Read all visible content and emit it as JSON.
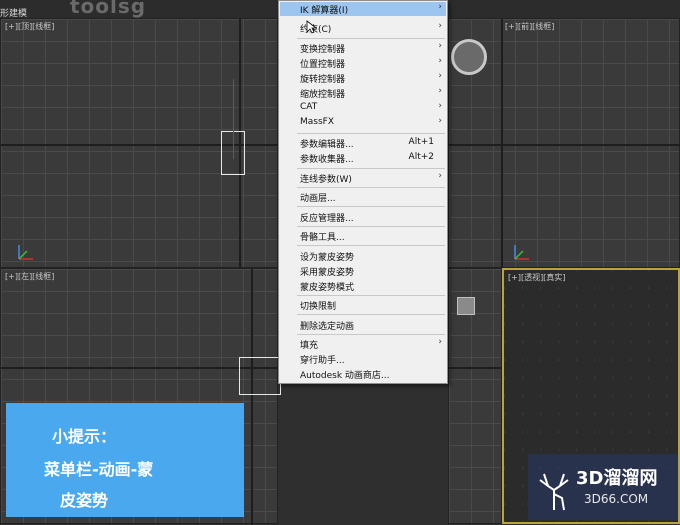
{
  "app": {
    "title_fragment": "形建模",
    "logo_text": "toolsg"
  },
  "viewports": {
    "top_left": {
      "label": "[+][顶][线框]"
    },
    "top_right": {
      "label": "[+][前][线框]"
    },
    "bottom_left": {
      "label": "[+][左][线框]"
    },
    "bottom_right": {
      "label": "[+][透视][真实]"
    }
  },
  "menu": {
    "items": [
      {
        "label": "IK 解算器(I)",
        "shortcut": "",
        "submenu": true,
        "highlight": true
      },
      {
        "label": "约束(C)",
        "shortcut": "",
        "submenu": true
      },
      {
        "label": "变换控制器",
        "shortcut": "",
        "submenu": true
      },
      {
        "label": "位置控制器",
        "shortcut": "",
        "submenu": true
      },
      {
        "label": "旋转控制器",
        "shortcut": "",
        "submenu": true
      },
      {
        "label": "缩放控制器",
        "shortcut": "",
        "submenu": true
      },
      {
        "label": "CAT",
        "shortcut": "",
        "submenu": true
      },
      {
        "label": "MassFX",
        "shortcut": "",
        "submenu": true
      },
      {
        "label": "参数编辑器...",
        "shortcut": "Alt+1",
        "submenu": false
      },
      {
        "label": "参数收集器...",
        "shortcut": "Alt+2",
        "submenu": false
      },
      {
        "label": "连线参数(W)",
        "shortcut": "",
        "submenu": true
      },
      {
        "label": "动画层...",
        "shortcut": "",
        "submenu": false
      },
      {
        "label": "反应管理器...",
        "shortcut": "",
        "submenu": false
      },
      {
        "label": "骨骼工具...",
        "shortcut": "",
        "submenu": false
      },
      {
        "label": "设为蒙皮姿势",
        "shortcut": "",
        "submenu": false
      },
      {
        "label": "采用蒙皮姿势",
        "shortcut": "",
        "submenu": false
      },
      {
        "label": "蒙皮姿势模式",
        "shortcut": "",
        "submenu": false
      },
      {
        "label": "切换限制",
        "shortcut": "",
        "submenu": false
      },
      {
        "label": "删除选定动画",
        "shortcut": "",
        "submenu": false
      },
      {
        "label": "填充",
        "shortcut": "",
        "submenu": true
      },
      {
        "label": "穿行助手...",
        "shortcut": "",
        "submenu": false
      },
      {
        "label": "Autodesk 动画商店...",
        "shortcut": "",
        "submenu": false
      }
    ]
  },
  "tip": {
    "line1": "小提示：",
    "line2": "菜单栏-动画-蒙",
    "line3": "皮姿势"
  },
  "watermark": {
    "main": "3D溜溜网",
    "sub": "3D66.COM"
  }
}
